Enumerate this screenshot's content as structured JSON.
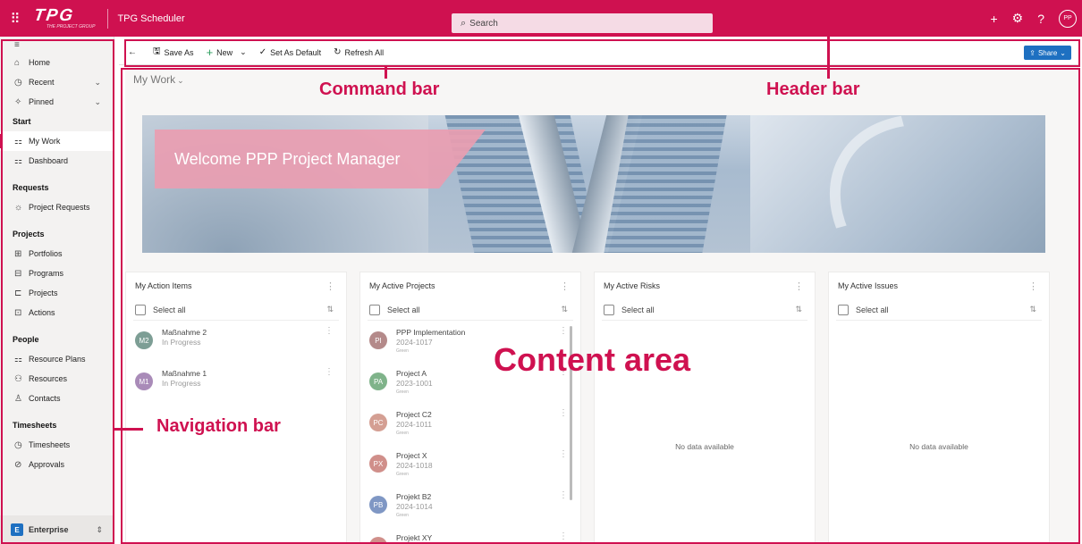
{
  "header": {
    "logo_text": "TPG",
    "logo_subtext": "THE PROJECT GROUP",
    "app_title": "TPG Scheduler",
    "search_placeholder": "Search",
    "avatar": "PP",
    "accent": "#cf1150"
  },
  "sidebar": {
    "top_items": [
      {
        "label": "Home",
        "icon": "home-icon"
      },
      {
        "label": "Recent",
        "icon": "clock-icon"
      },
      {
        "label": "Pinned",
        "icon": "pin-icon"
      }
    ],
    "sections": [
      {
        "title": "Start",
        "items": [
          {
            "label": "My Work"
          },
          {
            "label": "Dashboard"
          }
        ]
      },
      {
        "title": "Requests",
        "items": [
          {
            "label": "Project Requests"
          }
        ]
      },
      {
        "title": "Projects",
        "items": [
          {
            "label": "Portfolios"
          },
          {
            "label": "Programs"
          },
          {
            "label": "Projects"
          },
          {
            "label": "Actions"
          }
        ]
      },
      {
        "title": "People",
        "items": [
          {
            "label": "Resource Plans"
          },
          {
            "label": "Resources"
          },
          {
            "label": "Contacts"
          }
        ]
      },
      {
        "title": "Timesheets",
        "items": [
          {
            "label": "Timesheets"
          },
          {
            "label": "Approvals"
          }
        ]
      }
    ],
    "footer": {
      "badge": "E",
      "label": "Enterprise"
    }
  },
  "commandbar": {
    "save_as": "Save As",
    "new": "New",
    "set_default": "Set As Default",
    "refresh_all": "Refresh All",
    "share": "Share"
  },
  "content": {
    "page_title": "My Work",
    "welcome": "Welcome PPP Project Manager",
    "select_all": "Select all",
    "no_data": "No data available",
    "cards": {
      "action_items": {
        "title": "My Action Items",
        "rows": [
          {
            "initials": "M2",
            "name": "Maßnahme 2",
            "status": "In Progress",
            "color": "#7d9e95"
          },
          {
            "initials": "M1",
            "name": "Maßnahme 1",
            "status": "In Progress",
            "color": "#a98bb8"
          }
        ]
      },
      "active_projects": {
        "title": "My Active Projects",
        "rows": [
          {
            "initials": "PI",
            "name": "PPP Implementation",
            "code": "2024-1017",
            "health": "Green",
            "color": "#b48a8a"
          },
          {
            "initials": "PA",
            "name": "Project A",
            "code": "2023-1001",
            "health": "Green",
            "color": "#7fb38a"
          },
          {
            "initials": "PC",
            "name": "Project C2",
            "code": "2024-1011",
            "health": "Green",
            "color": "#d49f93"
          },
          {
            "initials": "PX",
            "name": "Project X",
            "code": "2024-1018",
            "health": "Green",
            "color": "#d08f8a"
          },
          {
            "initials": "PB",
            "name": "Projekt B2",
            "code": "2024-1014",
            "health": "Green",
            "color": "#7f97c4"
          },
          {
            "initials": "PX",
            "name": "Projekt XY",
            "code": "",
            "health": "",
            "color": "#d08f8a"
          }
        ]
      },
      "active_risks": {
        "title": "My Active Risks"
      },
      "active_issues": {
        "title": "My Active Issues"
      }
    }
  },
  "annotations": {
    "command_bar": "Command bar",
    "header_bar": "Header bar",
    "content_area": "Content area",
    "navigation_bar": "Navigation bar"
  }
}
